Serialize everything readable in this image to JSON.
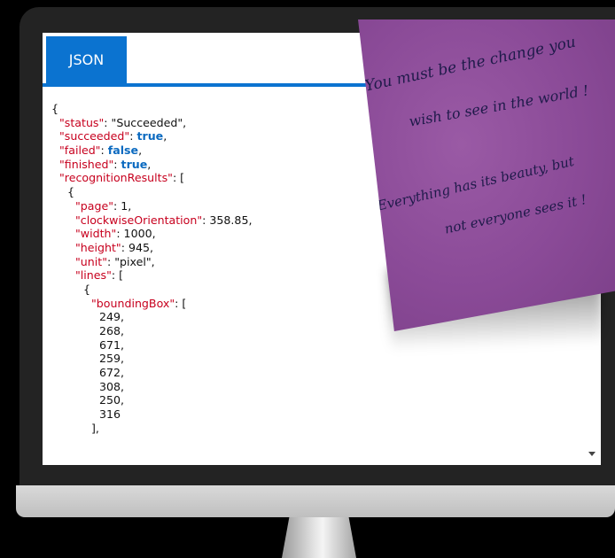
{
  "tab": {
    "label": "JSON"
  },
  "json_lines": [
    [
      {
        "t": "{",
        "c": ""
      }
    ],
    [
      {
        "t": "\"status\"",
        "c": "k"
      },
      {
        "t": ": \"Succeeded\",",
        "c": ""
      }
    ],
    [
      {
        "t": "\"succeeded\"",
        "c": "k"
      },
      {
        "t": ": ",
        "c": ""
      },
      {
        "t": "true",
        "c": "b"
      },
      {
        "t": ",",
        "c": ""
      }
    ],
    [
      {
        "t": "\"failed\"",
        "c": "k"
      },
      {
        "t": ": ",
        "c": ""
      },
      {
        "t": "false",
        "c": "b"
      },
      {
        "t": ",",
        "c": ""
      }
    ],
    [
      {
        "t": "\"finished\"",
        "c": "k"
      },
      {
        "t": ": ",
        "c": ""
      },
      {
        "t": "true",
        "c": "b"
      },
      {
        "t": ",",
        "c": ""
      }
    ],
    [
      {
        "t": "\"recognitionResults\"",
        "c": "k"
      },
      {
        "t": ": [",
        "c": ""
      }
    ],
    [
      {
        "t": "{",
        "c": ""
      }
    ],
    [
      {
        "t": "\"page\"",
        "c": "k"
      },
      {
        "t": ": 1,",
        "c": ""
      }
    ],
    [
      {
        "t": "\"clockwiseOrientation\"",
        "c": "k"
      },
      {
        "t": ": 358.85,",
        "c": ""
      }
    ],
    [
      {
        "t": "\"width\"",
        "c": "k"
      },
      {
        "t": ": 1000,",
        "c": ""
      }
    ],
    [
      {
        "t": "\"height\"",
        "c": "k"
      },
      {
        "t": ": 945,",
        "c": ""
      }
    ],
    [
      {
        "t": "\"unit\"",
        "c": "k"
      },
      {
        "t": ": \"pixel\",",
        "c": ""
      }
    ],
    [
      {
        "t": "\"lines\"",
        "c": "k"
      },
      {
        "t": ": [",
        "c": ""
      }
    ],
    [
      {
        "t": "{",
        "c": ""
      }
    ],
    [
      {
        "t": "\"boundingBox\"",
        "c": "k"
      },
      {
        "t": ": [",
        "c": ""
      }
    ],
    [
      {
        "t": "249,",
        "c": ""
      }
    ],
    [
      {
        "t": "268,",
        "c": ""
      }
    ],
    [
      {
        "t": "671,",
        "c": ""
      }
    ],
    [
      {
        "t": "259,",
        "c": ""
      }
    ],
    [
      {
        "t": "672,",
        "c": ""
      }
    ],
    [
      {
        "t": "308,",
        "c": ""
      }
    ],
    [
      {
        "t": "250,",
        "c": ""
      }
    ],
    [
      {
        "t": "316",
        "c": ""
      }
    ],
    [
      {
        "t": "],",
        "c": ""
      }
    ]
  ],
  "note": {
    "line1": "You must be the change you",
    "line2": "wish to see in the world !",
    "line3": "Everything has its beauty, but",
    "line4": "not everyone sees it !"
  },
  "colors": {
    "accent": "#0b73d0",
    "json_key": "#c7001e",
    "json_bool": "#0b6ac0",
    "note": "#8a4a97"
  }
}
